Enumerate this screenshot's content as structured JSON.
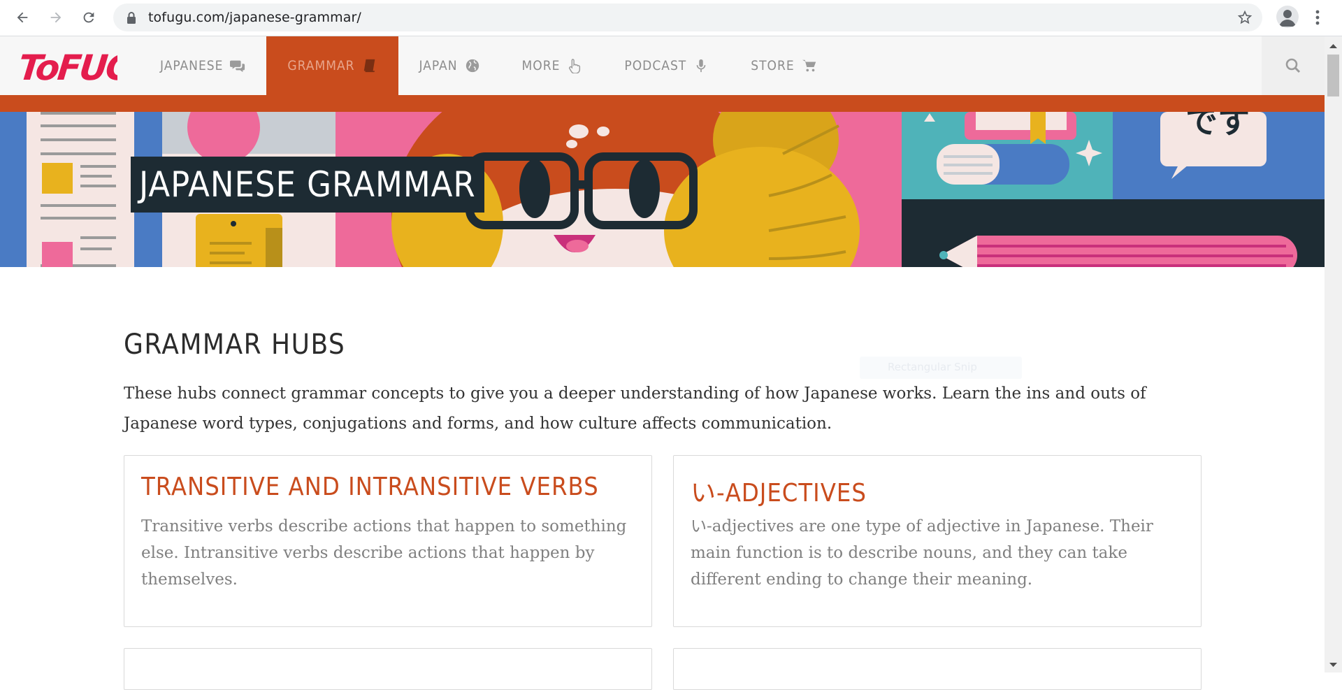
{
  "browser": {
    "url": "tofugu.com/japanese-grammar/",
    "icons": [
      "back-arrow-icon",
      "forward-arrow-icon",
      "reload-icon",
      "lock-icon",
      "star-icon",
      "profile-icon",
      "kebab-menu-icon"
    ]
  },
  "site": {
    "logo_text": "ToFUGU",
    "menu": [
      {
        "label": "JAPANESE",
        "icon": "chat-bubbles-icon",
        "active": false
      },
      {
        "label": "GRAMMAR",
        "icon": "book-icon",
        "active": true
      },
      {
        "label": "JAPAN",
        "icon": "globe-icon",
        "active": false
      },
      {
        "label": "MORE",
        "icon": "hand-pointer-icon",
        "active": false
      },
      {
        "label": "PODCAST",
        "icon": "microphone-icon",
        "active": false
      },
      {
        "label": "STORE",
        "icon": "cart-icon",
        "active": false
      }
    ],
    "search_icon": "search-icon",
    "colors": {
      "accent": "#c94c1d",
      "dark": "#1d2b33",
      "pink": "#ee6a9a",
      "teal": "#4fb3b9",
      "blue": "#4a7bc4",
      "yellow": "#e8b21e"
    }
  },
  "hero": {
    "title": "JAPANESE GRAMMAR",
    "speech_bubble": "です"
  },
  "main": {
    "section_title": "GRAMMAR HUBS",
    "intro": "These hubs connect grammar concepts to give you a deeper understanding of how Japanese works. Learn the ins and outs of Japanese word types, conjugations and forms, and how culture affects communication.",
    "cards": [
      {
        "title": "TRANSITIVE AND INTRANSITIVE VERBS",
        "text": "Transitive verbs describe actions that happen to something else. Intransitive verbs describe actions that happen by themselves."
      },
      {
        "title": "い-ADJECTIVES",
        "text": "い-adjectives are one type of adjective in Japanese. Their main function is to describe nouns, and they can take different ending to change their meaning."
      }
    ]
  },
  "overlay": {
    "snip_label": "Rectangular Snip"
  }
}
